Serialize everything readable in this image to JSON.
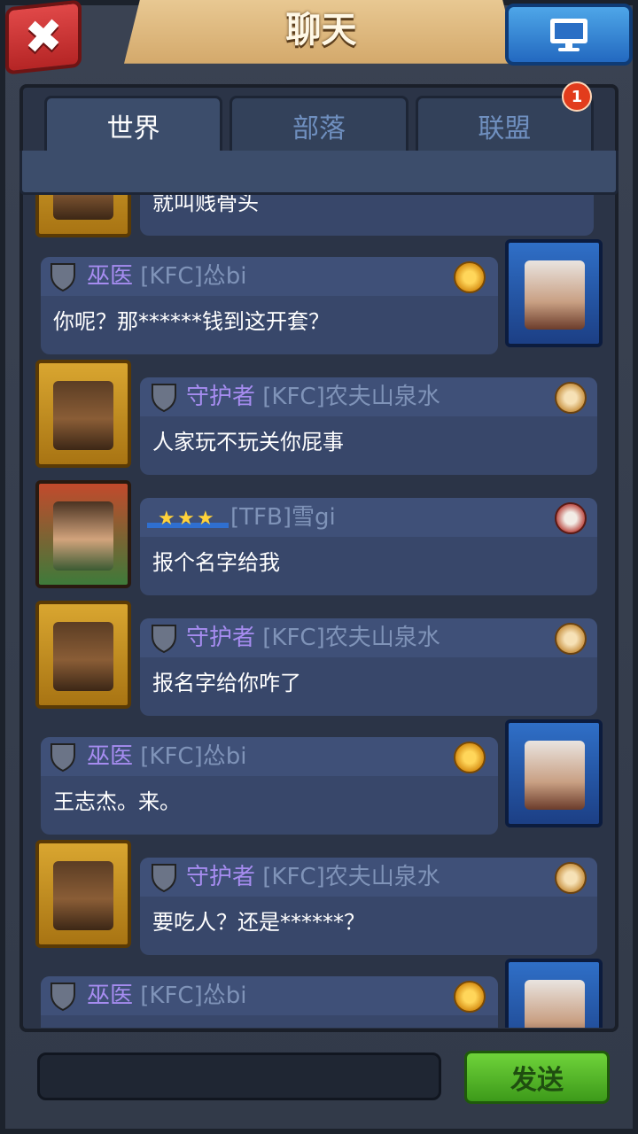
{
  "header": {
    "title": "聊天"
  },
  "tabs": [
    {
      "label": "世界",
      "active": true
    },
    {
      "label": "部落",
      "active": false
    },
    {
      "label": "联盟",
      "active": false
    }
  ],
  "notification_count": "1",
  "messages": [
    {
      "rank": "",
      "guild": "",
      "text": "就叫贱骨头",
      "side": "left",
      "avatar": "guardian"
    },
    {
      "rank": "巫医",
      "guild": "[KFC]怂bi",
      "text": "你呢？那******钱到这开套？",
      "side": "right",
      "avatar": "witch"
    },
    {
      "rank": "守护者",
      "guild": "[KFC]农夫山泉水",
      "text": "人家玩不玩关你屁事",
      "side": "left",
      "avatar": "guardian"
    },
    {
      "rank": "",
      "guild": "[TFB]雪gi",
      "text": "报个名字给我",
      "side": "left",
      "avatar": "hood",
      "stars": 3
    },
    {
      "rank": "守护者",
      "guild": "[KFC]农夫山泉水",
      "text": "报名字给你咋了",
      "side": "left",
      "avatar": "guardian"
    },
    {
      "rank": "巫医",
      "guild": "[KFC]怂bi",
      "text": "王志杰。来。",
      "side": "right",
      "avatar": "witch"
    },
    {
      "rank": "守护者",
      "guild": "[KFC]农夫山泉水",
      "text": "要吃人？还是******？",
      "side": "left",
      "avatar": "guardian"
    },
    {
      "rank": "巫医",
      "guild": "[KFC]怂bi",
      "text": "",
      "side": "right",
      "avatar": "witch"
    }
  ],
  "input": {
    "placeholder": ""
  },
  "send_label": "发送",
  "colors": {
    "rank_text": "#a68cf0",
    "guild_text": "#7f93b8",
    "bubble": "#38476a",
    "send_green": "#6fd33a"
  }
}
